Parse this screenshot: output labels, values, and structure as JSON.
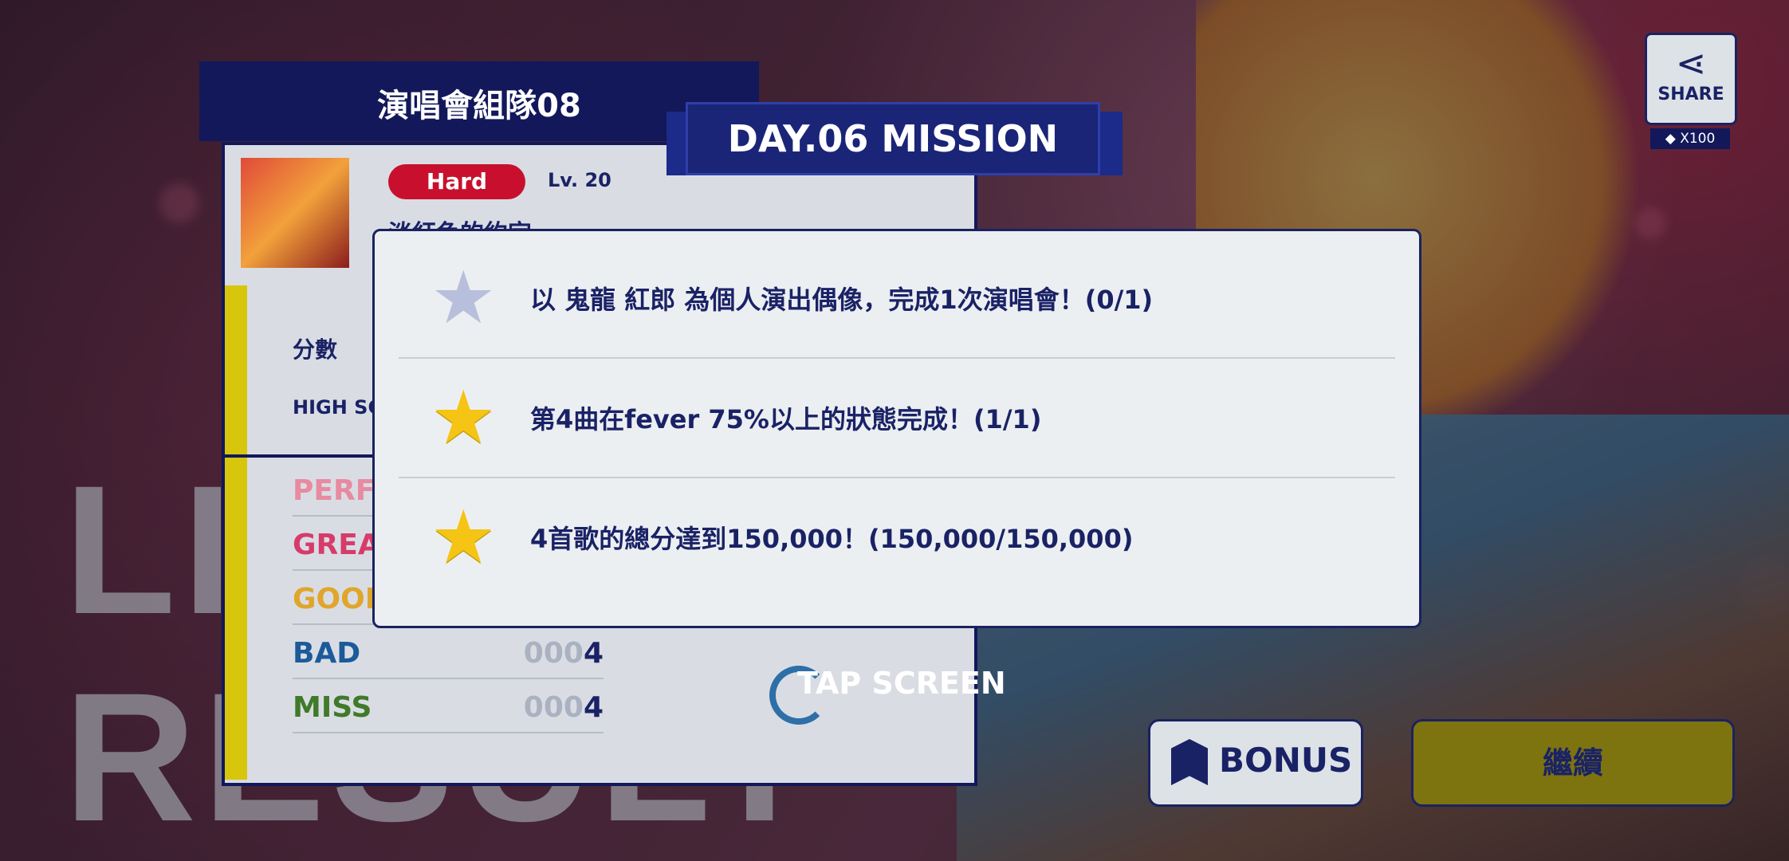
{
  "background": {
    "title_lines": [
      "LIVE",
      "RESULT"
    ]
  },
  "result_panel": {
    "unit_name": "演唱會組隊08",
    "difficulty": "Hard",
    "level": "Lv. 20",
    "song_title": "淡紅色的約定",
    "score_label": "分數",
    "highscore_label": "HIGH SCORE",
    "judgements": [
      {
        "label": "PERFECT",
        "zeros": "",
        "value": "",
        "color": "#e88aa0"
      },
      {
        "label": "GREAT",
        "zeros": "",
        "value": "",
        "color": "#d63c6a"
      },
      {
        "label": "GOOD",
        "zeros": "",
        "value": "",
        "color": "#e0a52a"
      },
      {
        "label": "BAD",
        "zeros": "000",
        "value": "4",
        "color": "#1c5a9a"
      },
      {
        "label": "MISS",
        "zeros": "000",
        "value": "4",
        "color": "#3f7a2a"
      }
    ]
  },
  "mission": {
    "banner": "DAY.06 MISSION",
    "items": [
      {
        "text": "以 鬼龍 紅郎 為個人演出偶像，完成1次演唱會！(0/1)",
        "done": false
      },
      {
        "text": "第4曲在fever 75%以上的狀態完成！(1/1)",
        "done": true
      },
      {
        "text": "4首歌的總分達到150,000！(150,000/150,000)",
        "done": true
      }
    ]
  },
  "tap_screen": "TAP SCREEN",
  "share": {
    "label": "SHARE",
    "cost": "X100",
    "icon": "share-icon"
  },
  "buttons": {
    "bonus": "BONUS",
    "continue": "繼續"
  }
}
